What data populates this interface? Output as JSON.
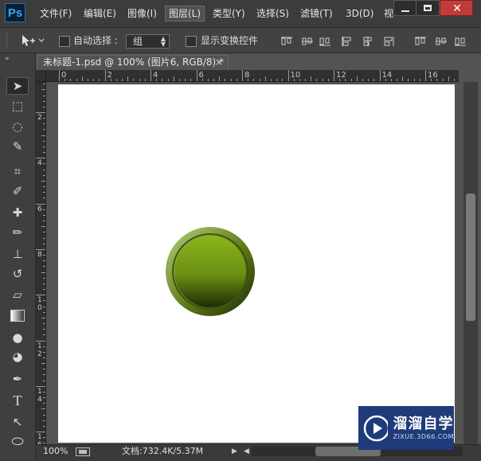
{
  "app": {
    "logo": "Ps"
  },
  "menu": [
    {
      "label": "文件(F)"
    },
    {
      "label": "编辑(E)"
    },
    {
      "label": "图像(I)"
    },
    {
      "label": "图层(L)",
      "active": true
    },
    {
      "label": "类型(Y)"
    },
    {
      "label": "选择(S)"
    },
    {
      "label": "滤镜(T)"
    },
    {
      "label": "3D(D)"
    },
    {
      "label": "视"
    }
  ],
  "options": {
    "auto_select_label": "自动选择 :",
    "auto_select_value": "组",
    "show_transform_label": "显示变换控件"
  },
  "document": {
    "tab_title": "未标题-1.psd @ 100% (图片6, RGB/8) *",
    "tab_close": "×"
  },
  "rulers": {
    "top": [
      "0",
      "2",
      "4",
      "6",
      "8",
      "10",
      "12",
      "14",
      "16"
    ],
    "left": [
      "2",
      "4",
      "6",
      "8",
      "1\n0",
      "1\n2",
      "1\n4",
      "1\n6"
    ]
  },
  "tools": [
    {
      "icon": "move-tool-icon",
      "active": true
    },
    {
      "icon": "marquee-tool-icon"
    },
    {
      "icon": "lasso-tool-icon"
    },
    {
      "icon": "quick-select-tool-icon"
    },
    {
      "icon": "crop-tool-icon"
    },
    {
      "icon": "eyedropper-tool-icon"
    },
    {
      "icon": "healing-brush-tool-icon"
    },
    {
      "icon": "brush-tool-icon"
    },
    {
      "icon": "clone-stamp-tool-icon"
    },
    {
      "icon": "history-brush-tool-icon"
    },
    {
      "icon": "eraser-tool-icon"
    },
    {
      "icon": "gradient-tool-icon"
    },
    {
      "icon": "blur-tool-icon"
    },
    {
      "icon": "dodge-tool-icon"
    },
    {
      "icon": "pen-tool-icon"
    },
    {
      "icon": "type-tool-icon",
      "glyph": "T"
    },
    {
      "icon": "path-select-tool-icon"
    },
    {
      "icon": "ellipse-tool-icon"
    }
  ],
  "canvas": {
    "button_colors": {
      "light": "#b6d27a",
      "mid": "#8ab61c",
      "dark": "#1e2a05",
      "rim": "#5e7a18"
    }
  },
  "status": {
    "zoom": "100%",
    "doc_info": "文档:732.4K/5.37M"
  },
  "watermark": {
    "title": "溜溜自学",
    "url": "ZIXUE.3D66.COM"
  }
}
